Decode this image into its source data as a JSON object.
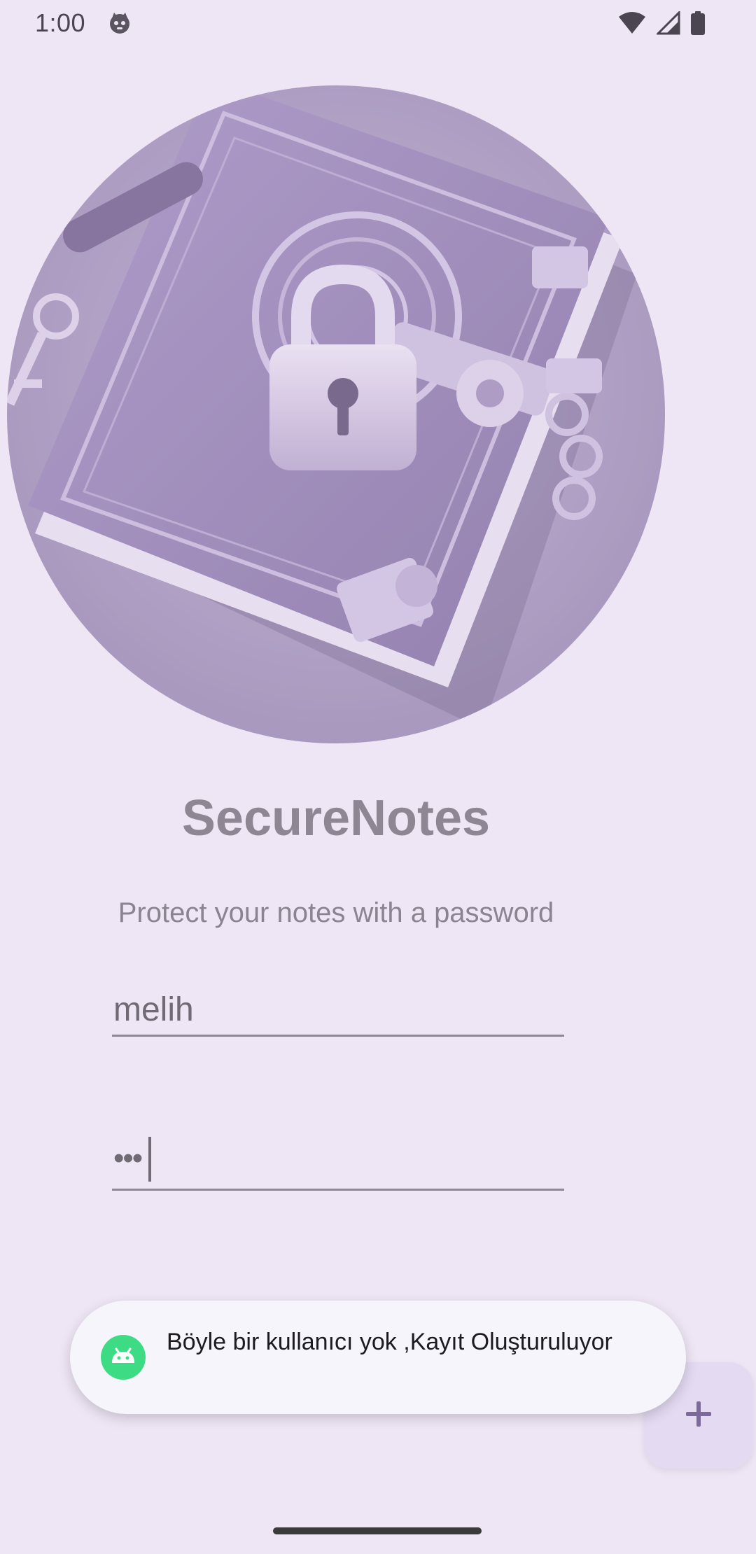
{
  "status_bar": {
    "time": "1:00",
    "icons": [
      "cat-app-icon",
      "wifi-icon",
      "signal-icon",
      "battery-icon"
    ]
  },
  "hero": {
    "icon": "locked-notebook-image"
  },
  "app": {
    "title": "SecureNotes",
    "subtitle": "Protect your notes with a password"
  },
  "login": {
    "username_value": "melih",
    "password_masked": "•••"
  },
  "toast": {
    "message": "Böyle bir kullanıcı yok ,Kayıt Oluşturuluyor",
    "icon": "android-icon"
  },
  "fab": {
    "icon": "plus-icon"
  },
  "colors": {
    "background": "#EFE6F5",
    "title": "#8E8693",
    "toast_background": "#F6F5FB",
    "fab_background": "#E4DAF2",
    "accent": "#7D6A9A"
  }
}
